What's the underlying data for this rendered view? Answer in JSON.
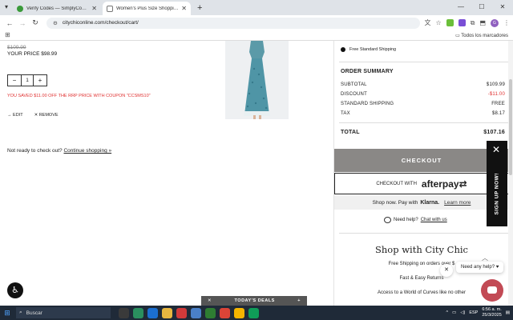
{
  "browser": {
    "tabs": [
      {
        "title": "Verify Codes — SimplyCodes",
        "active": false
      },
      {
        "title": "Women's Plus Size Shopping C",
        "active": true
      }
    ],
    "url": "citychiconline.com/checkout/cart/",
    "avatar_initial": "G",
    "bookmarks_all": "Todos los marcadores"
  },
  "cart": {
    "rrp": "$109.99",
    "your_price": "YOUR PRICE $98.99",
    "quantity": "1",
    "saved_message": "YOU SAVED $11.00 OFF THE RRP PRICE WITH COUPON \"CCSMS10\"",
    "edit_label": "EDIT",
    "remove_label": "REMOVE",
    "not_ready": "Not ready to check out?",
    "continue_shopping": "Continue shopping »"
  },
  "summary": {
    "shipping_option": "Free Standard Shipping",
    "title": "ORDER SUMMARY",
    "rows": [
      {
        "label": "SUBTOTAL",
        "value": "$109.99"
      },
      {
        "label": "DISCOUNT",
        "value": "-$11.00"
      },
      {
        "label": "STANDARD SHIPPING",
        "value": "FREE"
      },
      {
        "label": "TAX",
        "value": "$8.17"
      }
    ],
    "total_label": "TOTAL",
    "total_value": "$107.16",
    "checkout_label": "CHECKOUT",
    "afterpay_prefix": "CHECKOUT WITH",
    "afterpay_brand": "afterpay",
    "klarna_text": "Shop now. Pay with",
    "klarna_brand": "Klarna.",
    "klarna_link": "Learn more",
    "help_text": "Need help?",
    "help_link": "Chat with us",
    "shop_with_title": "Shop with City Chic",
    "perks": [
      "Free Shipping on orders over $",
      "Fast & Easy Returns",
      "Access to a World of Curves like no other"
    ]
  },
  "widgets": {
    "signup": "SIGN UP NOW!",
    "chat_tip": "Need any help? ♥",
    "todays_deals": "TODAY'S DEALS"
  },
  "taskbar": {
    "search_placeholder": "Buscar",
    "lang": "ESP",
    "time": "6:56 a. m.",
    "date": "25/3/2025"
  }
}
